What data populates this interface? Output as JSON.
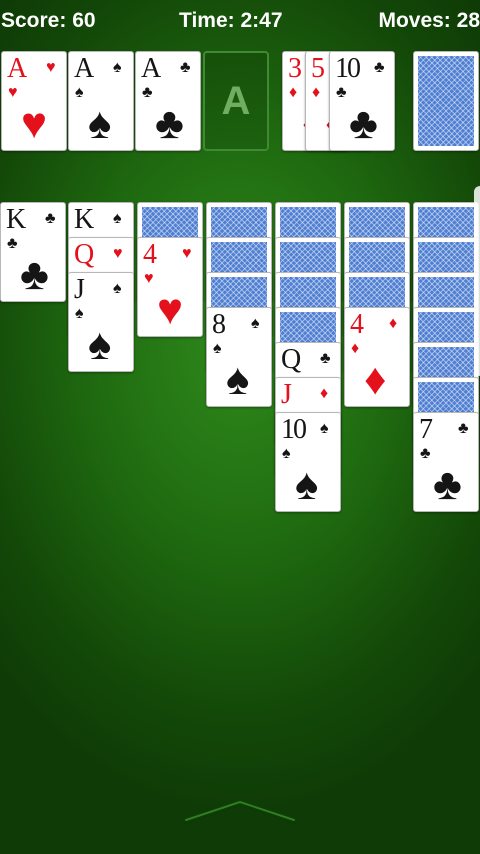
{
  "status": {
    "score_text": "Score: 60",
    "time_text": "Time: 2:47",
    "moves_text": "Moves: 28"
  },
  "foundations": [
    {
      "rank": "A",
      "suit": "heart",
      "color": "red"
    },
    {
      "rank": "A",
      "suit": "spade",
      "color": "black"
    },
    {
      "rank": "A",
      "suit": "club",
      "color": "black"
    },
    {
      "empty_label": "A"
    }
  ],
  "waste": [
    {
      "rank": "3",
      "suit": "diamond",
      "color": "red"
    },
    {
      "rank": "5",
      "suit": "diamond",
      "color": "red"
    },
    {
      "rank": "10",
      "suit": "club",
      "color": "black"
    }
  ],
  "stock": {
    "icon": "card-back"
  },
  "tableau": [
    {
      "face_down": 0,
      "face_up": [
        {
          "rank": "K",
          "suit": "club",
          "color": "black"
        }
      ]
    },
    {
      "face_down": 0,
      "face_up": [
        {
          "rank": "K",
          "suit": "spade",
          "color": "black"
        },
        {
          "rank": "Q",
          "suit": "heart",
          "color": "red"
        },
        {
          "rank": "J",
          "suit": "spade",
          "color": "black"
        }
      ]
    },
    {
      "face_down": 1,
      "face_up": [
        {
          "rank": "4",
          "suit": "heart",
          "color": "red"
        }
      ]
    },
    {
      "face_down": 3,
      "face_up": [
        {
          "rank": "8",
          "suit": "spade",
          "color": "black"
        }
      ]
    },
    {
      "face_down": 4,
      "face_up": [
        {
          "rank": "Q",
          "suit": "club",
          "color": "black"
        },
        {
          "rank": "J",
          "suit": "diamond",
          "color": "red"
        },
        {
          "rank": "10",
          "suit": "spade",
          "color": "black"
        }
      ]
    },
    {
      "face_down": 3,
      "face_up": [
        {
          "rank": "4",
          "suit": "diamond",
          "color": "red"
        }
      ]
    },
    {
      "face_down": 6,
      "face_up": [
        {
          "rank": "7",
          "suit": "club",
          "color": "black"
        }
      ]
    }
  ],
  "colors": {
    "felt": "#1f6a10",
    "card_red": "#e4101c",
    "card_black": "#151515",
    "card_back": "#4f7fd2"
  },
  "icons": {
    "drawer": "chevron-up-icon"
  }
}
